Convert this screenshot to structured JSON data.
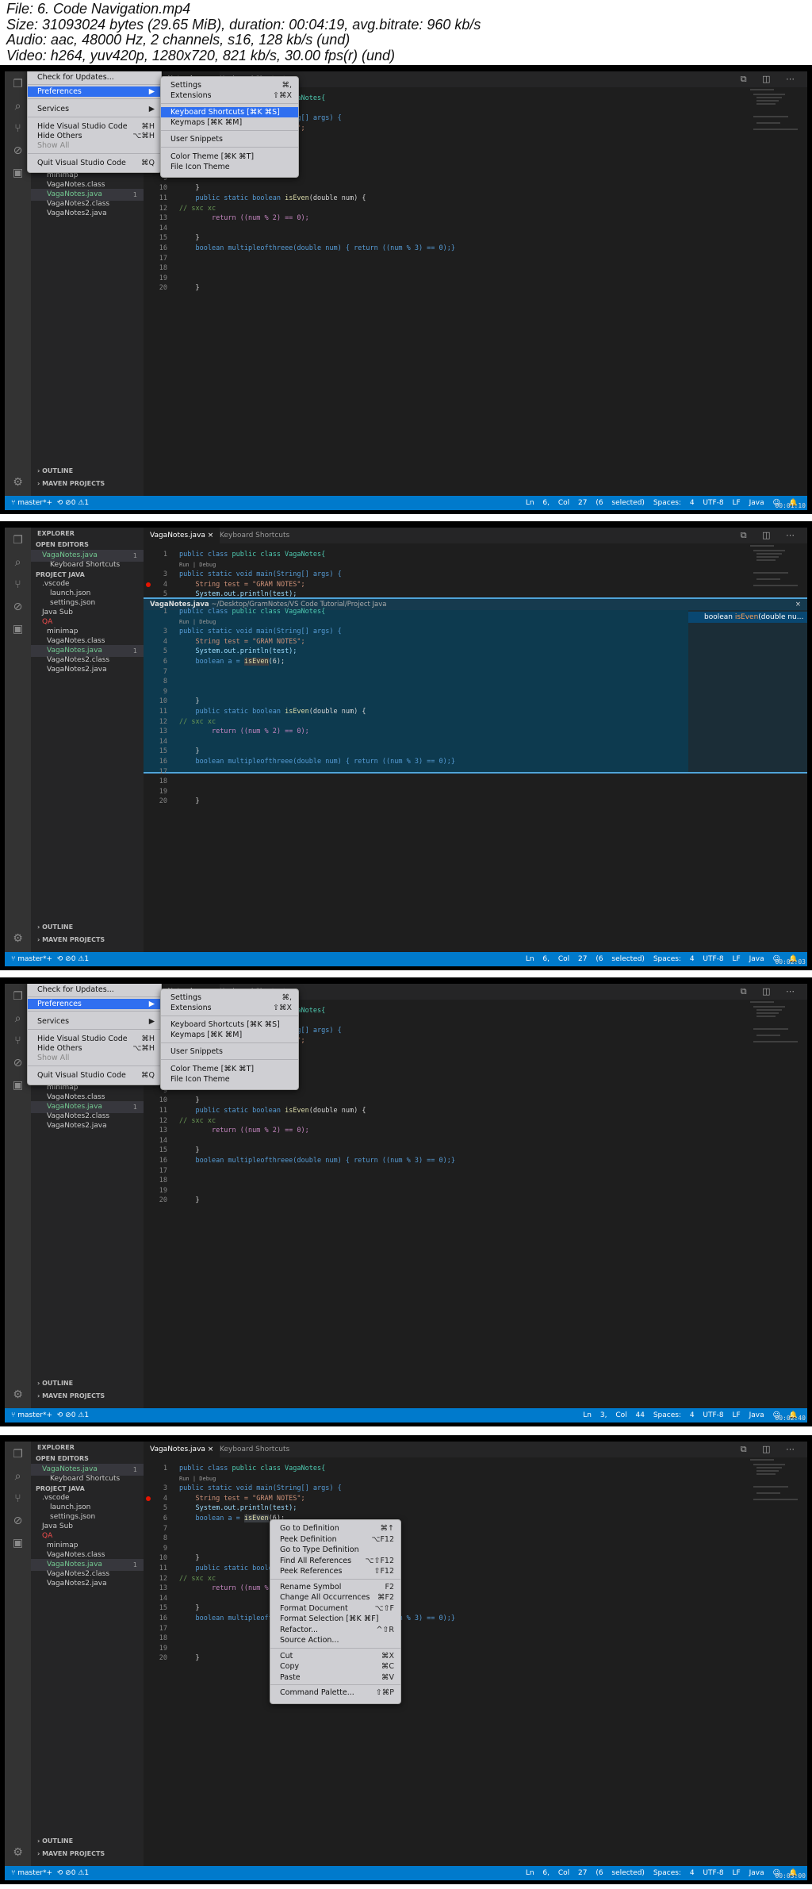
{
  "header": {
    "lines": [
      "File: 6. Code Navigation.mp4",
      "Size: 31093024 bytes (29.65 MiB), duration: 00:04:19, avg.bitrate: 960 kb/s",
      "Audio: aac, 48000 Hz, 2 channels, s16, 128 kb/s (und)",
      "Video: h264, yuv420p, 1280x720, 821 kb/s, 30.00 fps(r) (und)"
    ]
  },
  "explorer": {
    "title": "EXPLORER",
    "open_editors": "OPEN EDITORS",
    "open1": "VagaNotes.java",
    "open1_badge": "1",
    "open2": "Keyboard Shortcuts",
    "project": "PROJECT JAVA",
    "vscode": ".vscode",
    "launch": "launch.json",
    "settings": "settings.json",
    "javasub": "Java Sub",
    "qa": "QA",
    "minimap": "minimap",
    "f1": "VagaNotes.class",
    "f2": "VagaNotes.java",
    "f2_badge": "1",
    "f3": "VagaNotes2.class",
    "f4": "VagaNotes2.java",
    "outline": "OUTLINE",
    "maven": "MAVEN PROJECTS"
  },
  "tabs": {
    "t1": "VagaNotes.java",
    "t2": "Keyboard Shortcuts"
  },
  "code": {
    "l1": "public class VagaNotes{",
    "lens": "Run | Debug",
    "l3a": "public static void main(String[] args) {",
    "l4": "String test = \"GRAM NOTES\";",
    "l5": "System.out.println(test);",
    "l6a": "boolean a = ",
    "l6b": "isEven",
    "l6c": "(6);",
    "l10": "}",
    "l11a": "public static boolean ",
    "l11b": "isEven",
    "l11c": "(double num) {",
    "l12": "// sxc xc",
    "l13": "return ((num % 2) == 0);",
    "l15": "}",
    "l16": "boolean multipleofthreee(double num) { return ((num % 3) == 0);}",
    "l20": "}"
  },
  "status": {
    "branch": "master*+",
    "sync": "⟲ ⊘0 ⚠1",
    "p1": "Ln 6, Col 27 (6 selected)",
    "p2": "Ln 6, Col 27 (6 selected)",
    "p3": "Ln 3, Col 44",
    "p4": "Ln 6, Col 27 (6 selected)",
    "spaces": "Spaces: 4",
    "enc": "UTF-8",
    "eol": "LF",
    "lang": "Java"
  },
  "timestamps": {
    "p1": "00:01:10",
    "p2": "00:02:03",
    "p3": "00:02:40",
    "p4": "00:03:00"
  },
  "app_menu": {
    "check": "Check for Updates...",
    "prefs": "Preferences",
    "services": "Services",
    "hide": "Hide Visual Studio Code",
    "hide_k": "⌘H",
    "hide_others": "Hide Others",
    "hide_others_k": "⌥⌘H",
    "show_all": "Show All",
    "quit": "Quit Visual Studio Code",
    "quit_k": "⌘Q"
  },
  "prefs_menu": {
    "settings": "Settings",
    "settings_k": "⌘,",
    "extensions": "Extensions",
    "extensions_k": "⇧⌘X",
    "kb": "Keyboard Shortcuts [⌘K ⌘S]",
    "keymaps": "Keymaps [⌘K ⌘M]",
    "snippets": "User Snippets",
    "color": "Color Theme [⌘K ⌘T]",
    "file_icon": "File Icon Theme"
  },
  "peek": {
    "title": "VagaNotes.java",
    "path": "~/Desktop/GramNotes/VS Code Tutorial/Project Java",
    "ref_a": "boolean ",
    "ref_b": "isEven",
    "ref_c": "(double nu...",
    "close": "×"
  },
  "context_menu": {
    "items": [
      [
        "Go to Definition",
        "⌘↑"
      ],
      [
        "Peek Definition",
        "⌥F12"
      ],
      [
        "Go to Type Definition",
        ""
      ],
      [
        "Find All References",
        "⌥⇧F12"
      ],
      [
        "Peek References",
        "⇧F12"
      ],
      [
        "Rename Symbol",
        "F2"
      ],
      [
        "Change All Occurrences",
        "⌘F2"
      ],
      [
        "Format Document",
        "⌥⇧F"
      ],
      [
        "Format Selection [⌘K ⌘F]",
        ""
      ],
      [
        "Refactor...",
        "^⇧R"
      ],
      [
        "Source Action...",
        ""
      ],
      [
        "Cut",
        "⌘X"
      ],
      [
        "Copy",
        "⌘C"
      ],
      [
        "Paste",
        "⌘V"
      ],
      [
        "Command Palette...",
        "⇧⌘P"
      ]
    ]
  },
  "colors": {
    "status_bar": "#007acc",
    "activity": "#333333",
    "sidebar": "#252526",
    "editor": "#1e1e1e",
    "menu": "#cfcfd3",
    "highlight": "#2f6ff0"
  }
}
